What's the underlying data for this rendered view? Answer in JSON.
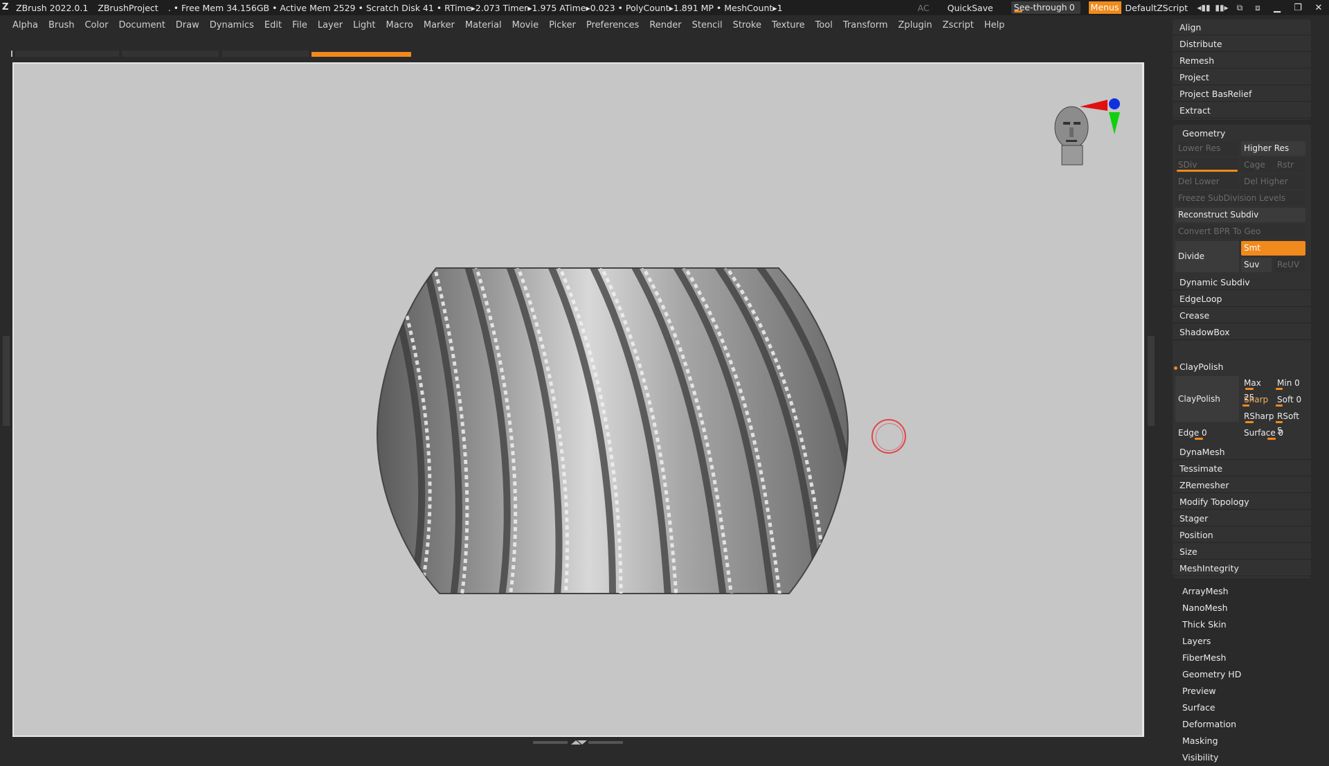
{
  "titlebar": {
    "app": "ZBrush 2022.0.1",
    "project": "ZBrushProject",
    "stats": ". • Free Mem 34.156GB • Active Mem 2529 • Scratch Disk 41  • RTime▸2.073 Timer▸1.975 ATime▸0.023 • PolyCount▸1.891 MP  • MeshCount▸1",
    "ac": "AC",
    "quicksave": "QuickSave",
    "seethrough_label": "See-through",
    "seethrough_value": "0",
    "menus": "Menus",
    "default_zscript": "DefaultZScript"
  },
  "menubar": [
    "Alpha",
    "Brush",
    "Color",
    "Document",
    "Draw",
    "Dynamics",
    "Edit",
    "File",
    "Layer",
    "Light",
    "Macro",
    "Marker",
    "Material",
    "Movie",
    "Picker",
    "Preferences",
    "Render",
    "Stencil",
    "Stroke",
    "Texture",
    "Tool",
    "Transform",
    "Zplugin",
    "Zscript",
    "Help"
  ],
  "panel": {
    "top_items": [
      "Align",
      "Distribute",
      "Remesh",
      "Project",
      "Project BasRelief",
      "Extract"
    ],
    "geometry": {
      "title": "Geometry",
      "lower_res": "Lower Res",
      "higher_res": "Higher Res",
      "sdiv": "SDiv",
      "cage": "Cage",
      "rstr": "Rstr",
      "del_lower": "Del Lower",
      "del_higher": "Del Higher",
      "freeze": "Freeze SubDivision Levels",
      "reconstruct": "Reconstruct Subdiv",
      "convert_bpr": "Convert BPR To Geo",
      "divide": "Divide",
      "smt": "Smt",
      "suv": "Suv",
      "reuv": "ReUV",
      "items_a": [
        "Dynamic Subdiv",
        "EdgeLoop",
        "Crease",
        "ShadowBox"
      ],
      "claypolish_title": "ClayPolish",
      "claypolish_btn": "ClayPolish",
      "max": "Max 25",
      "min": "Min 0",
      "sharp": "Sharp",
      "soft": "Soft 0",
      "rsharp": "RSharp",
      "rsoft": "RSoft 5",
      "edge": "Edge 0",
      "surface": "Surface 0",
      "items_b": [
        "DynaMesh",
        "Tessimate",
        "ZRemesher",
        "Modify Topology",
        "Stager",
        "Position",
        "Size",
        "MeshIntegrity"
      ]
    },
    "subpalettes": [
      "ArrayMesh",
      "NanoMesh",
      "Thick Skin",
      "Layers",
      "FiberMesh",
      "Geometry HD",
      "Preview",
      "Surface",
      "Deformation",
      "Masking",
      "Visibility"
    ]
  },
  "colors": {
    "accent": "#f08a1c",
    "viewport_bg": "#c6c6c6",
    "panel_bg": "#323232"
  }
}
